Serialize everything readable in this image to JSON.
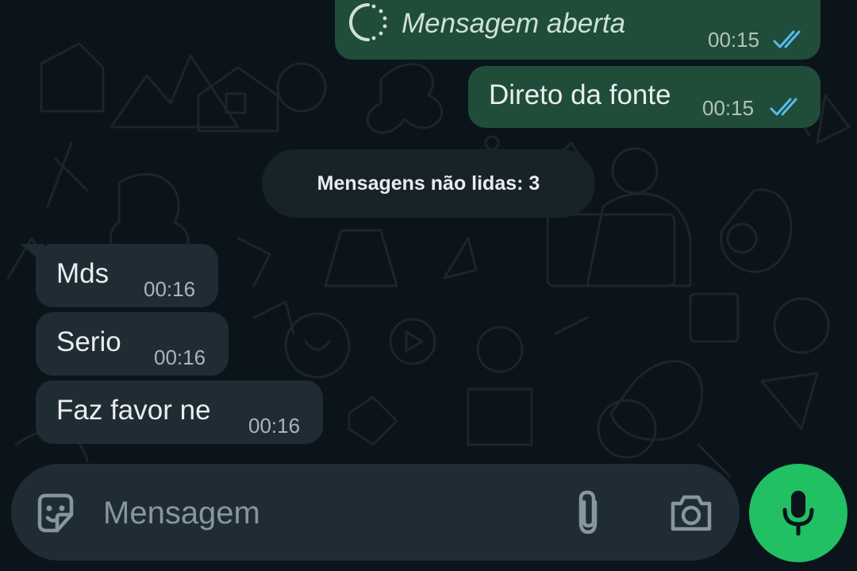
{
  "messages_out": [
    {
      "text": "Mensagem aberta",
      "time": "00:15",
      "status_icon": "double-check-read-icon",
      "icon": "view-once-opened-icon"
    },
    {
      "text": "Direto da fonte",
      "time": "00:15",
      "status_icon": "double-check-read-icon"
    }
  ],
  "unread_divider": {
    "label": "Mensagens não lidas: 3"
  },
  "messages_in": [
    {
      "text": "Mds",
      "time": "00:16"
    },
    {
      "text": "Serio",
      "time": "00:16"
    },
    {
      "text": "Faz favor ne",
      "time": "00:16"
    }
  ],
  "composer": {
    "placeholder": "Mensagem",
    "emoji_icon": "sticker-icon",
    "attach_icon": "paperclip-icon",
    "camera_icon": "camera-icon",
    "send_icon": "microphone-icon"
  },
  "colors": {
    "background": "#0b141a",
    "outgoing_bubble": "#1f4d3a",
    "incoming_bubble": "#1f2c33",
    "read_ticks": "#53bdeb",
    "mic_button": "#21c063"
  }
}
